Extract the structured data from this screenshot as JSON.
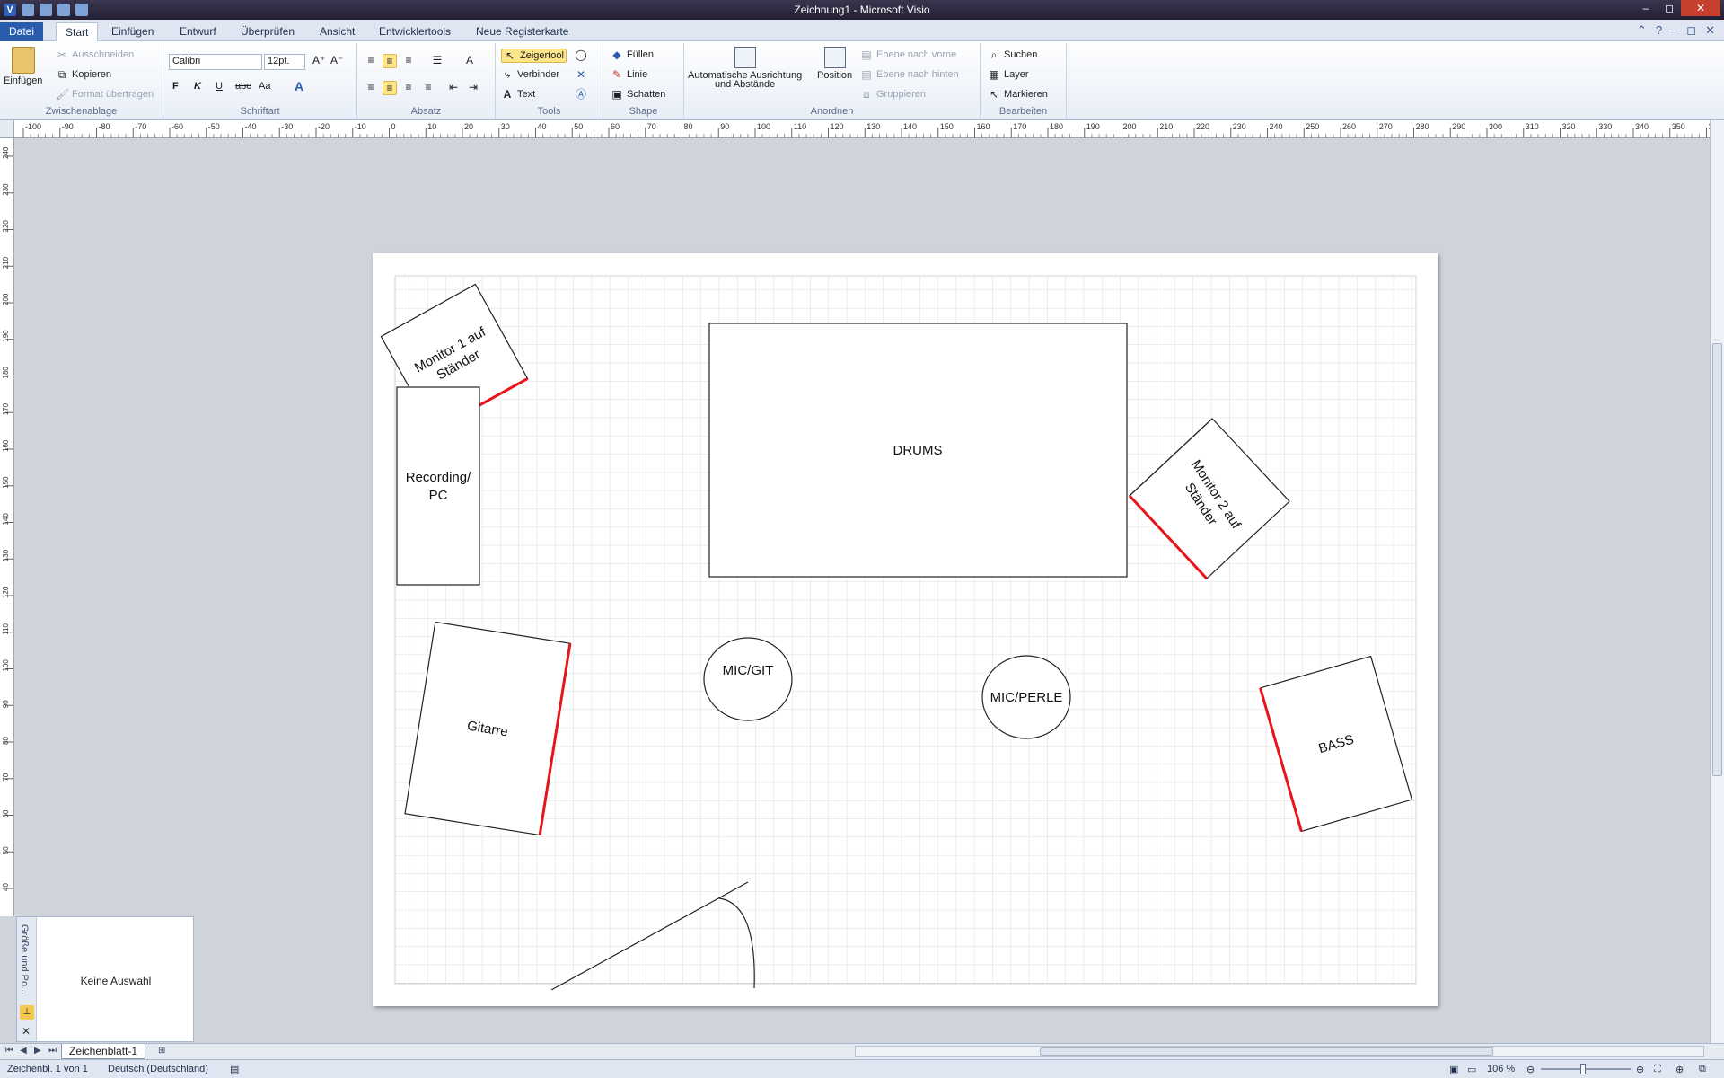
{
  "window": {
    "title": "Zeichnung1 - Microsoft Visio",
    "qat_app_icon": "V",
    "buttons": [
      "–",
      "◻",
      "✕"
    ]
  },
  "tabs": [
    "Datei",
    "Start",
    "Einfügen",
    "Entwurf",
    "Überprüfen",
    "Ansicht",
    "Entwicklertools",
    "Neue Registerkarte"
  ],
  "active_tab": "Start",
  "ribbon": {
    "clipboard": {
      "label": "Zwischenablage",
      "paste": "Einfügen",
      "cut": "Ausschneiden",
      "copy": "Kopieren",
      "format": "Format übertragen"
    },
    "font": {
      "label": "Schriftart",
      "family": "Calibri",
      "size": "12pt.",
      "bold": "F",
      "italic": "K",
      "underline": "U",
      "strike": "abc",
      "case": "Aa",
      "color": "A"
    },
    "paragraph": {
      "label": "Absatz"
    },
    "tools": {
      "label": "Tools",
      "pointer": "Zeigertool",
      "connector": "Verbinder",
      "text": "Text"
    },
    "shape": {
      "label": "Shape",
      "fill": "Füllen",
      "line": "Linie",
      "shadow": "Schatten"
    },
    "arrange": {
      "label": "Anordnen",
      "auto": "Automatische Ausrichtung und Abstände",
      "auto_line1": "Automatische Ausrichtung",
      "auto_line2": "und Abstände",
      "position": "Position",
      "front": "Ebene nach vorne",
      "back": "Ebene nach hinten",
      "group": "Gruppieren"
    },
    "edit": {
      "label": "Bearbeiten",
      "find": "Suchen",
      "layer": "Layer",
      "select": "Markieren"
    }
  },
  "ruler": {
    "h_ticks": [
      "-100",
      "-90",
      "-80",
      "-70",
      "-60",
      "-50",
      "-40",
      "-30",
      "-20",
      "-10",
      "0",
      "10",
      "20",
      "30",
      "40",
      "50",
      "60",
      "70",
      "80",
      "90",
      "100",
      "110",
      "120",
      "130",
      "140",
      "150",
      "160",
      "170",
      "180",
      "190",
      "200",
      "210",
      "220",
      "230",
      "240",
      "250",
      "260",
      "270",
      "280",
      "290",
      "300",
      "310",
      "320",
      "330",
      "340",
      "350",
      "360"
    ],
    "v_ticks": [
      "240",
      "230",
      "220",
      "210",
      "200",
      "190",
      "180",
      "170",
      "160",
      "150",
      "140",
      "130",
      "120",
      "110",
      "100",
      "90",
      "80",
      "70",
      "60",
      "50",
      "40",
      "30",
      "20"
    ]
  },
  "diagram": {
    "shapes": [
      {
        "id": "monitor1",
        "line1": "Monitor 1 auf",
        "line2": "Ständer"
      },
      {
        "id": "recording",
        "line1": "Recording/",
        "line2": "PC"
      },
      {
        "id": "drums",
        "line1": "DRUMS"
      },
      {
        "id": "monitor2",
        "line1": "Monitor 2 auf",
        "line2": "Ständer"
      },
      {
        "id": "gitarre",
        "line1": "Gitarre"
      },
      {
        "id": "micgit",
        "line1": "MIC/GIT"
      },
      {
        "id": "micperle",
        "line1": "MIC/PERLE"
      },
      {
        "id": "bass",
        "line1": "BASS"
      }
    ],
    "accent": "#e8141a"
  },
  "size_panel": {
    "title": "Größe und Po...",
    "message": "Keine Auswahl"
  },
  "sheet": {
    "name": "Zeichenblatt-1"
  },
  "status": {
    "page": "Zeichenbl. 1 von 1",
    "language": "Deutsch (Deutschland)",
    "zoom": "106 %"
  }
}
